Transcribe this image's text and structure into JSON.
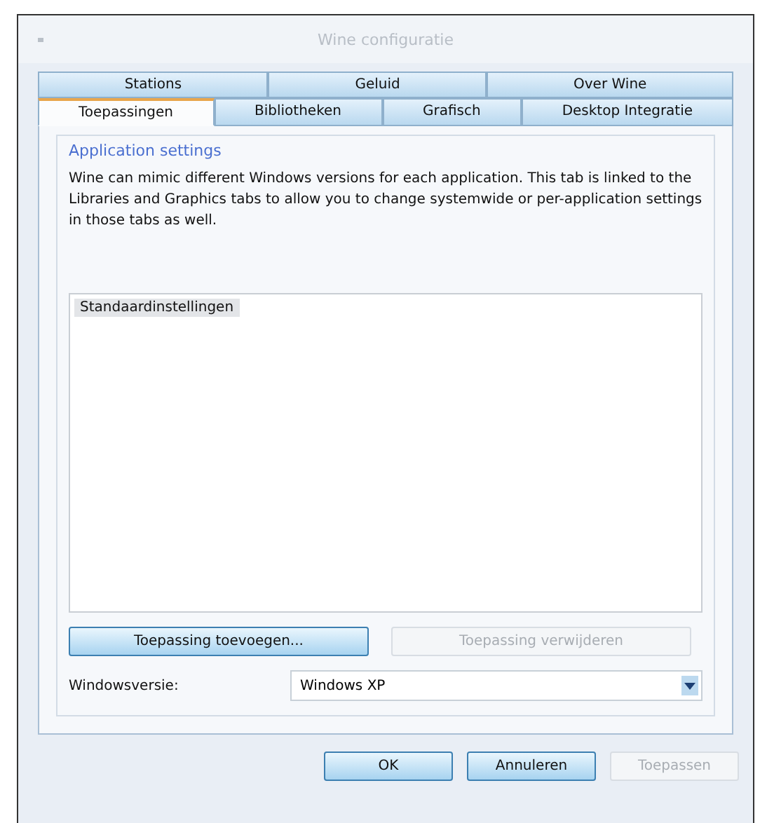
{
  "window": {
    "title": "Wine configuratie"
  },
  "tab_rows": [
    [
      {
        "label": "Stations",
        "selected": false
      },
      {
        "label": "Geluid",
        "selected": false
      },
      {
        "label": "Over Wine",
        "selected": false
      }
    ],
    [
      {
        "label": "Toepassingen",
        "selected": true
      },
      {
        "label": "Bibliotheken",
        "selected": false
      },
      {
        "label": "Grafisch",
        "selected": false
      },
      {
        "label": "Desktop Integratie",
        "selected": false
      }
    ]
  ],
  "group": {
    "title": "Application settings",
    "description": "Wine can mimic different Windows versions for each application. This tab is linked to the Libraries and Graphics tabs to allow you to change systemwide or per-application settings in those tabs as well."
  },
  "applications": [
    {
      "label": "Standaardinstellingen",
      "selected": true
    }
  ],
  "app_buttons": [
    {
      "label": "Toepassing toevoegen...",
      "disabled": false
    },
    {
      "label": "Toepassing verwijderen",
      "disabled": true
    }
  ],
  "windows_version": {
    "label": "Windowsversie:",
    "value": "Windows XP"
  },
  "buttons": [
    {
      "label": "OK",
      "disabled": false
    },
    {
      "label": "Annuleren",
      "disabled": false
    },
    {
      "label": "Toepassen",
      "disabled": true
    }
  ]
}
